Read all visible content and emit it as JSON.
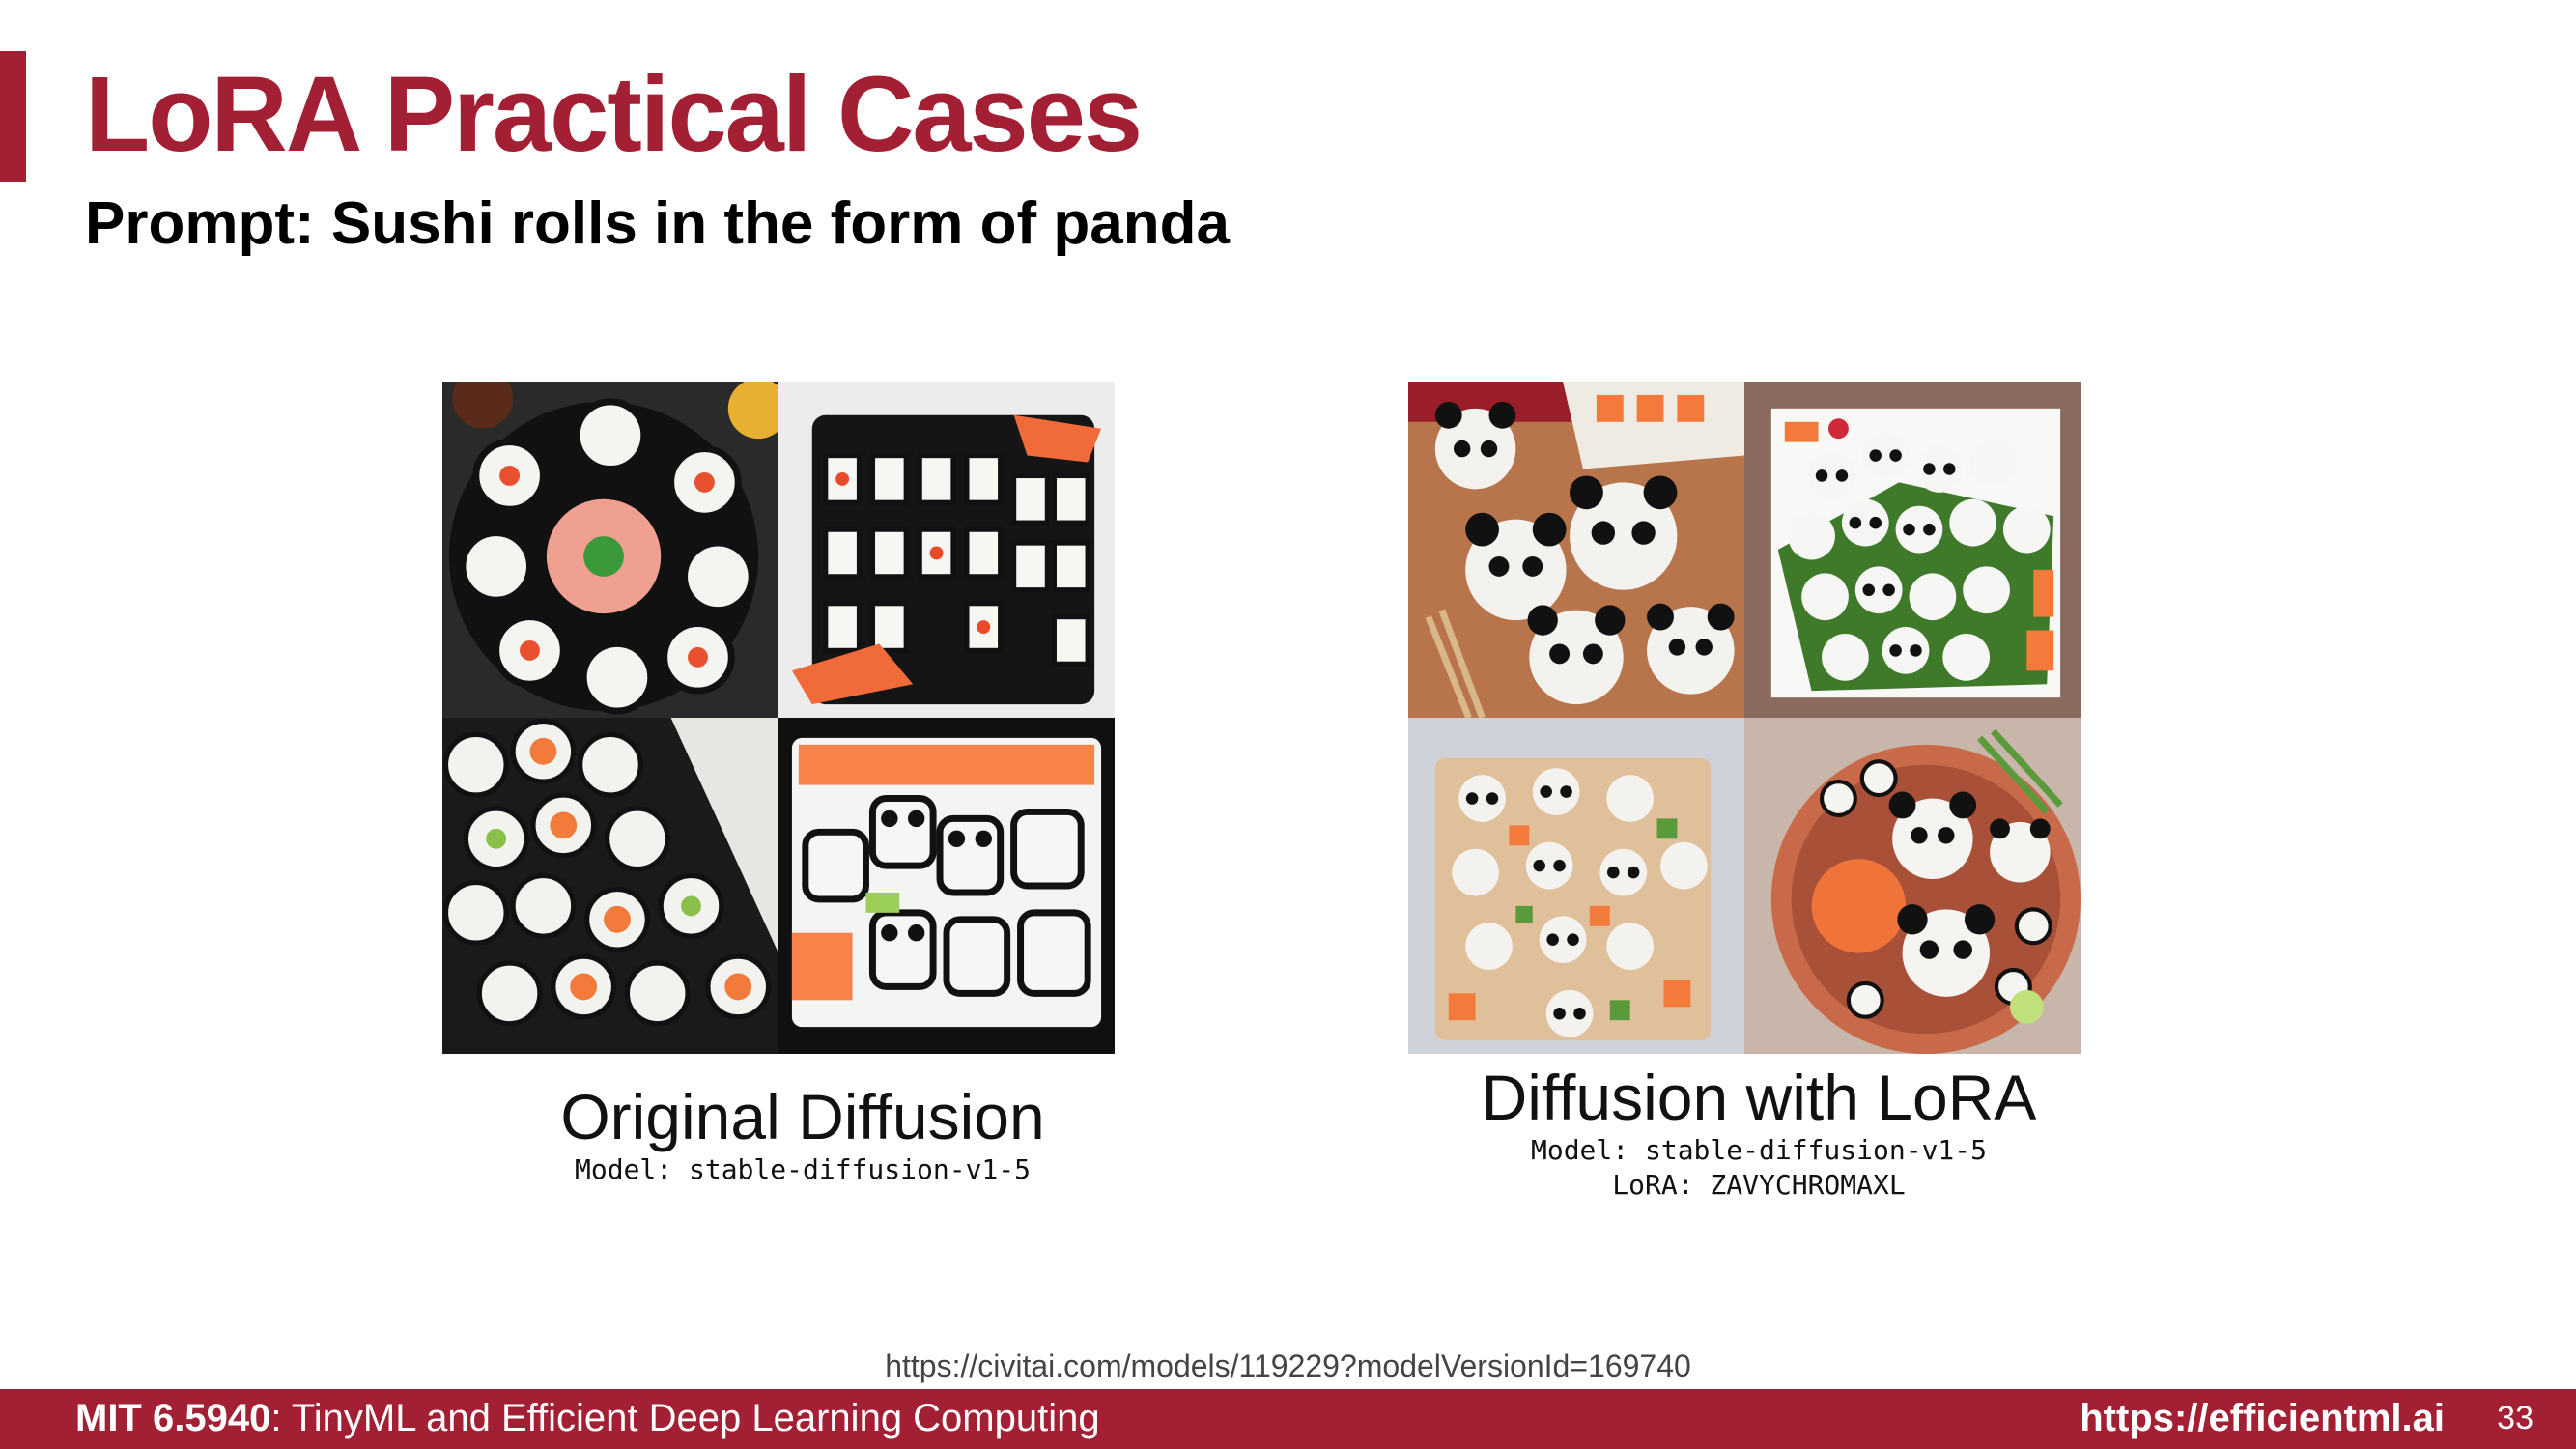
{
  "slide": {
    "title": "LoRA Practical Cases",
    "subtitle": "Prompt: Sushi rolls in the form of panda",
    "left_panel": {
      "caption": "Original Diffusion",
      "model_line": "Model: stable-diffusion-v1-5"
    },
    "right_panel": {
      "caption": "Diffusion with LoRA",
      "model_line": "Model: stable-diffusion-v1-5",
      "lora_line": "LoRA: ZAVYCHROMAXL"
    },
    "source_url": "https://civitai.com/models/119229?modelVersionId=169740"
  },
  "footer": {
    "course_code": "MIT 6.5940",
    "course_title": ": TinyML and Efficient Deep Learning Computing",
    "website": "https://efficientml.ai",
    "page_number": "33"
  },
  "colors": {
    "accent": "#a31f34",
    "text": "#000000"
  }
}
